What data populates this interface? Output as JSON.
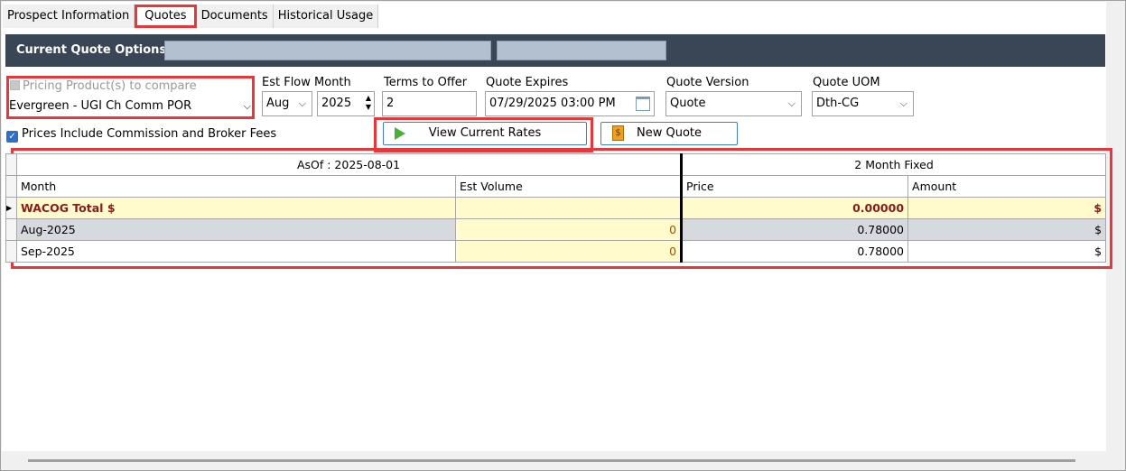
{
  "tabs": [
    {
      "label": "Prospect Information"
    },
    {
      "label": "Quotes"
    },
    {
      "label": "Documents"
    },
    {
      "label": "Historical Usage"
    }
  ],
  "header": {
    "title": "Current Quote Options"
  },
  "pricing": {
    "checkbox_label": "Pricing Product(s) to compare",
    "product": "Evergreen - UGI Ch Comm POR"
  },
  "est_flow": {
    "label": "Est Flow Month",
    "month": "Aug",
    "year": "2025"
  },
  "terms": {
    "label": "Terms to Offer",
    "value": "2"
  },
  "expires": {
    "label": "Quote Expires",
    "value": "07/29/2025 03:00 PM"
  },
  "version": {
    "label": "Quote Version",
    "value": "Quote"
  },
  "uom": {
    "label": "Quote UOM",
    "value": "Dth-CG"
  },
  "commission": {
    "label": "Prices Include Commission and Broker Fees"
  },
  "buttons": {
    "view_rates": "View Current Rates",
    "new_quote": "New Quote"
  },
  "grid": {
    "group_left": "AsOf : 2025-08-01",
    "group_right": "2 Month Fixed",
    "columns": [
      "Month",
      "Est Volume",
      "Price",
      "Amount"
    ],
    "rows": [
      {
        "month": "WACOG Total $",
        "volume": "",
        "price": "0.00000",
        "amount": "$"
      },
      {
        "month": "Aug-2025",
        "volume": "0",
        "price": "0.78000",
        "amount": "$"
      },
      {
        "month": "Sep-2025",
        "volume": "0",
        "price": "0.78000",
        "amount": "$"
      }
    ]
  },
  "colors": {
    "accent": "#e8363b",
    "header_bg": "#3a4656",
    "link_blue": "#3d7fd6"
  }
}
